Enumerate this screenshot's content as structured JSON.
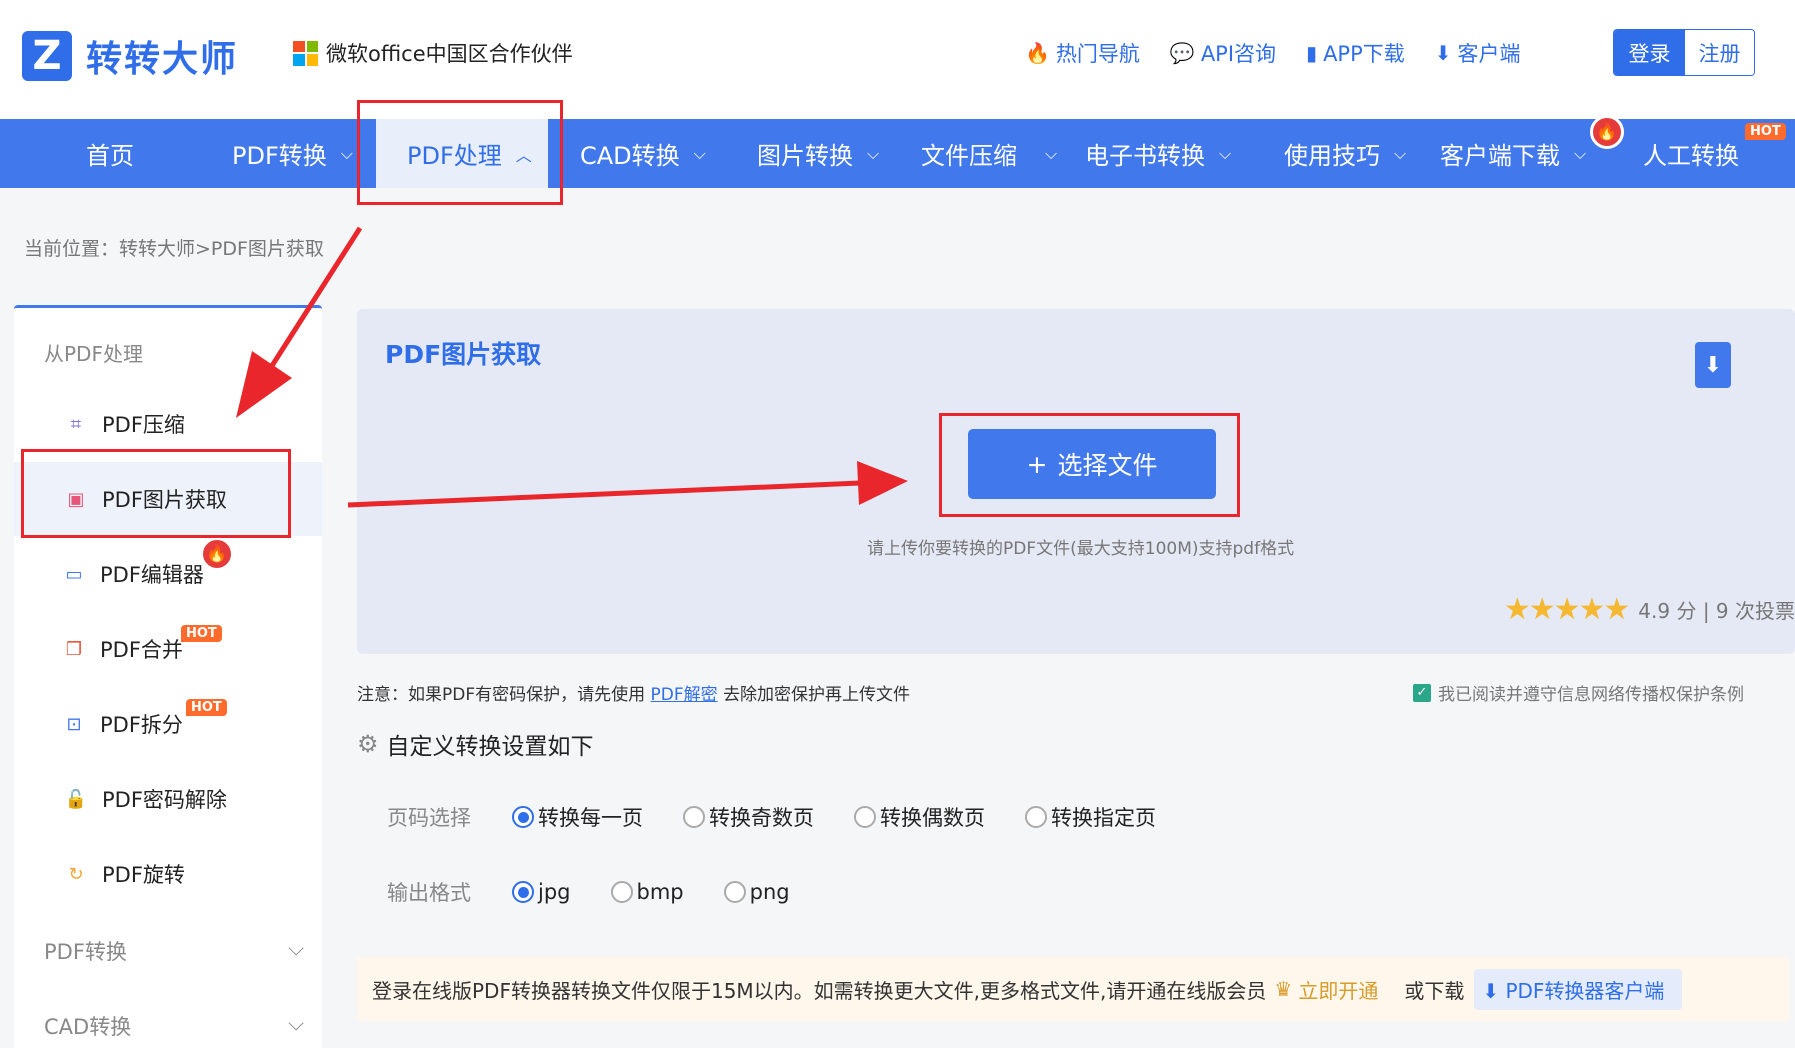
{
  "header": {
    "logo_mark": "Z",
    "logo_text": "转转大师",
    "partner_text": "微软office中国区合作伙伴",
    "links": [
      {
        "label": "热门导航",
        "icon": "flame-icon",
        "glyph": "🔥"
      },
      {
        "label": "API咨询",
        "icon": "chat-icon",
        "glyph": "💬"
      },
      {
        "label": "APP下载",
        "icon": "phone-icon",
        "glyph": "▮"
      },
      {
        "label": "客户端",
        "icon": "download-icon",
        "glyph": "⬇"
      }
    ],
    "login_label": "登录",
    "register_label": "注册"
  },
  "nav": {
    "items": [
      {
        "label": "首页",
        "chevron": ""
      },
      {
        "label": "PDF转换",
        "chevron": "⌵"
      },
      {
        "label": "PDF处理",
        "chevron": "︿"
      },
      {
        "label": "CAD转换",
        "chevron": "⌵"
      },
      {
        "label": "图片转换",
        "chevron": "⌵"
      },
      {
        "label": "文件压缩",
        "chevron": "⌵"
      },
      {
        "label": "电子书转换",
        "chevron": "⌵"
      },
      {
        "label": "使用技巧",
        "chevron": "⌵"
      },
      {
        "label": "客户端下载",
        "chevron": "⌵"
      },
      {
        "label": "人工转换",
        "chevron": ""
      }
    ],
    "hot_badge": "HOT"
  },
  "breadcrumb": "当前位置：转转大师>PDF图片获取",
  "sidebar": {
    "heading": "从PDF处理",
    "items": [
      {
        "label": "PDF压缩",
        "icon": "compress-icon",
        "glyph": "⌗",
        "color": "#7b6ee8"
      },
      {
        "label": "PDF图片获取",
        "icon": "image-extract-icon",
        "glyph": "▣",
        "color": "#e8557a"
      },
      {
        "label": "PDF编辑器",
        "icon": "monitor-edit-icon",
        "glyph": "▭",
        "color": "#4179ec"
      },
      {
        "label": "PDF合并",
        "icon": "merge-icon",
        "glyph": "❐",
        "color": "#e8553b"
      },
      {
        "label": "PDF拆分",
        "icon": "split-icon",
        "glyph": "⊡",
        "color": "#4179ec"
      },
      {
        "label": "PDF密码解除",
        "icon": "unlock-icon",
        "glyph": "🔓",
        "color": "#e8557a"
      },
      {
        "label": "PDF旋转",
        "icon": "rotate-icon",
        "glyph": "↻",
        "color": "#f3a63b"
      }
    ],
    "hot_badge": "HOT",
    "groups": [
      "PDF转换",
      "CAD转换"
    ]
  },
  "upload": {
    "title": "PDF图片获取",
    "select_label": "选择文件",
    "plus": "+",
    "hint": "请上传你要转换的PDF文件(最大支持100M)支持pdf格式",
    "stars": "★★★★★",
    "rating_text": "4.9  分 | 9 次投票"
  },
  "note": {
    "prefix": "注意：如果PDF有密码保护，请先使用",
    "link": "PDF解密",
    "suffix": "去除加密保护再上传文件"
  },
  "agree_text": "我已阅读并遵守信息网络传播权保护条例",
  "settings": {
    "title": "自定义转换设置如下",
    "page_label": "页码选择",
    "page_options": [
      "转换每一页",
      "转换奇数页",
      "转换偶数页",
      "转换指定页"
    ],
    "format_label": "输出格式",
    "format_options": [
      "jpg",
      "bmp",
      "png"
    ]
  },
  "promo": {
    "text": "登录在线版PDF转换器转换文件仅限于15M以内。如需转换更大文件,更多格式文件,请开通在线版会员",
    "vip_label": "立即开通",
    "or_text": "或下载",
    "download_label": "PDF转换器客户端"
  },
  "colors": {
    "brand": "#4179ec",
    "annotation": "#e8262b"
  }
}
